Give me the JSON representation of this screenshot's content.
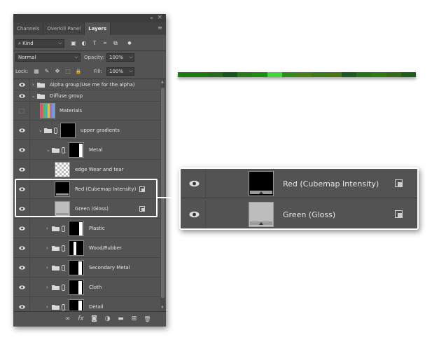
{
  "panel": {
    "collapse_glyph": "«",
    "close_glyph": "×",
    "menu_glyph": "≡",
    "tabs": [
      {
        "label": "Channels"
      },
      {
        "label": "Overkill Panel"
      },
      {
        "label": "Layers"
      }
    ],
    "active_tab": "Layers",
    "filter": {
      "kind_label": "Kind",
      "search_icon": "search-icon",
      "chevron": "⌵"
    },
    "filter_icons": [
      "image-filter-icon",
      "adjustment-filter-icon",
      "type-filter-icon",
      "shape-filter-icon",
      "smart-object-filter-icon",
      "filter-toggle-icon"
    ],
    "filter_glyphs": [
      "▣",
      "◐",
      "T",
      "⌗",
      "⧉",
      "●"
    ],
    "blend_mode": "Normal",
    "opacity_label": "Opacity:",
    "opacity_value": "100%",
    "lock_label": "Lock:",
    "lock_icons": [
      "lock-transparent-icon",
      "lock-paint-icon",
      "lock-move-icon",
      "lock-artboard-icon",
      "lock-all-icon"
    ],
    "lock_glyphs": [
      "▦",
      "✎",
      "✥",
      "⬚",
      "🔒"
    ],
    "fill_label": "Fill:",
    "fill_value": "100%",
    "layers": [
      {
        "name": "Alpha group(Use me for the alpha)",
        "kind": "group",
        "visible": true
      },
      {
        "name": "Diffuse group",
        "kind": "group-open",
        "visible": true
      },
      {
        "name": "Materials",
        "kind": "rainbow",
        "visible": false
      },
      {
        "name": "upper gradients",
        "kind": "group-mask",
        "visible": true
      },
      {
        "name": "Metal",
        "kind": "group-mask",
        "visible": true
      },
      {
        "name": "edge Wear and tear",
        "kind": "checker",
        "visible": true
      },
      {
        "name": "Red (Cubemap Intensity)",
        "kind": "black",
        "visible": true
      },
      {
        "name": "Green (Gloss)",
        "kind": "gray",
        "visible": true
      },
      {
        "name": "Plastic",
        "kind": "group-mask",
        "visible": true
      },
      {
        "name": "Wood/Rubber",
        "kind": "group-mask",
        "visible": true
      },
      {
        "name": "Secondary Metal",
        "kind": "group-mask",
        "visible": true
      },
      {
        "name": "Cloth",
        "kind": "group-mask",
        "visible": true
      },
      {
        "name": "Detail",
        "kind": "group-mask",
        "visible": true
      }
    ],
    "footer_icons": [
      "link-layers-icon",
      "fx-icon",
      "add-mask-icon",
      "adjustment-layer-icon",
      "new-group-icon",
      "new-layer-icon",
      "delete-layer-icon"
    ],
    "footer_glyphs": [
      "∞",
      "fx",
      "◙",
      "◑",
      "▬",
      "⊞",
      "🗑"
    ]
  },
  "zoom": {
    "rows": [
      {
        "name": "Red (Cubemap Intensity)"
      },
      {
        "name": "Green (Gloss)"
      }
    ]
  },
  "strip": {
    "colors": [
      "#1d7a12",
      "#1d7a12",
      "#27691a",
      "#17561d",
      "#2a7a19",
      "#1f8c12",
      "#44d53a",
      "#2e8d1b",
      "#4b7f18",
      "#3b7a1d",
      "#4b7413",
      "#1a5a22",
      "#24731b",
      "#2e7a12",
      "#356b18",
      "#1c5f1a"
    ]
  }
}
